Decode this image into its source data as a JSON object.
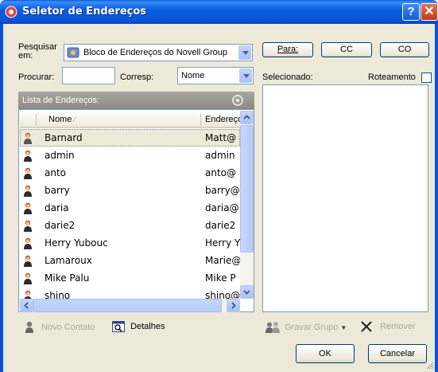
{
  "window": {
    "title": "Seletor de Endereços"
  },
  "search": {
    "label": "Pesquisar em:",
    "book": "Bloco de Endereços do Novell Group",
    "find_label": "Procurar:",
    "find_value": "",
    "match_label": "Corresp:",
    "match_value": "Nome"
  },
  "list": {
    "header": "Lista de Endereços:",
    "columns": {
      "name": "Nome",
      "address": "Endereço"
    },
    "rows": [
      {
        "name": "Barnard",
        "address": "Matt@"
      },
      {
        "name": "admin",
        "address": "admin"
      },
      {
        "name": "anto",
        "address": "anto@"
      },
      {
        "name": "barry",
        "address": "barry@"
      },
      {
        "name": "daria",
        "address": "daria@"
      },
      {
        "name": "darie2",
        "address": "darie2"
      },
      {
        "name": "Herry Yubouc",
        "address": "Herry Y"
      },
      {
        "name": "Lamaroux",
        "address": "Marie@"
      },
      {
        "name": "Mike Palu",
        "address": "Mike P"
      },
      {
        "name": "shino",
        "address": "shino@"
      }
    ]
  },
  "buttons": {
    "to": "Para:",
    "cc": "CC",
    "bc": "CO",
    "new_contact": "Novo Contato",
    "details": "Detalhes",
    "save_group": "Gravar Grupo",
    "remove": "Remover",
    "ok": "OK",
    "cancel": "Cancelar"
  },
  "selected": {
    "label": "Selecionado:",
    "routing_label": "Roteamento",
    "routing_checked": false
  }
}
